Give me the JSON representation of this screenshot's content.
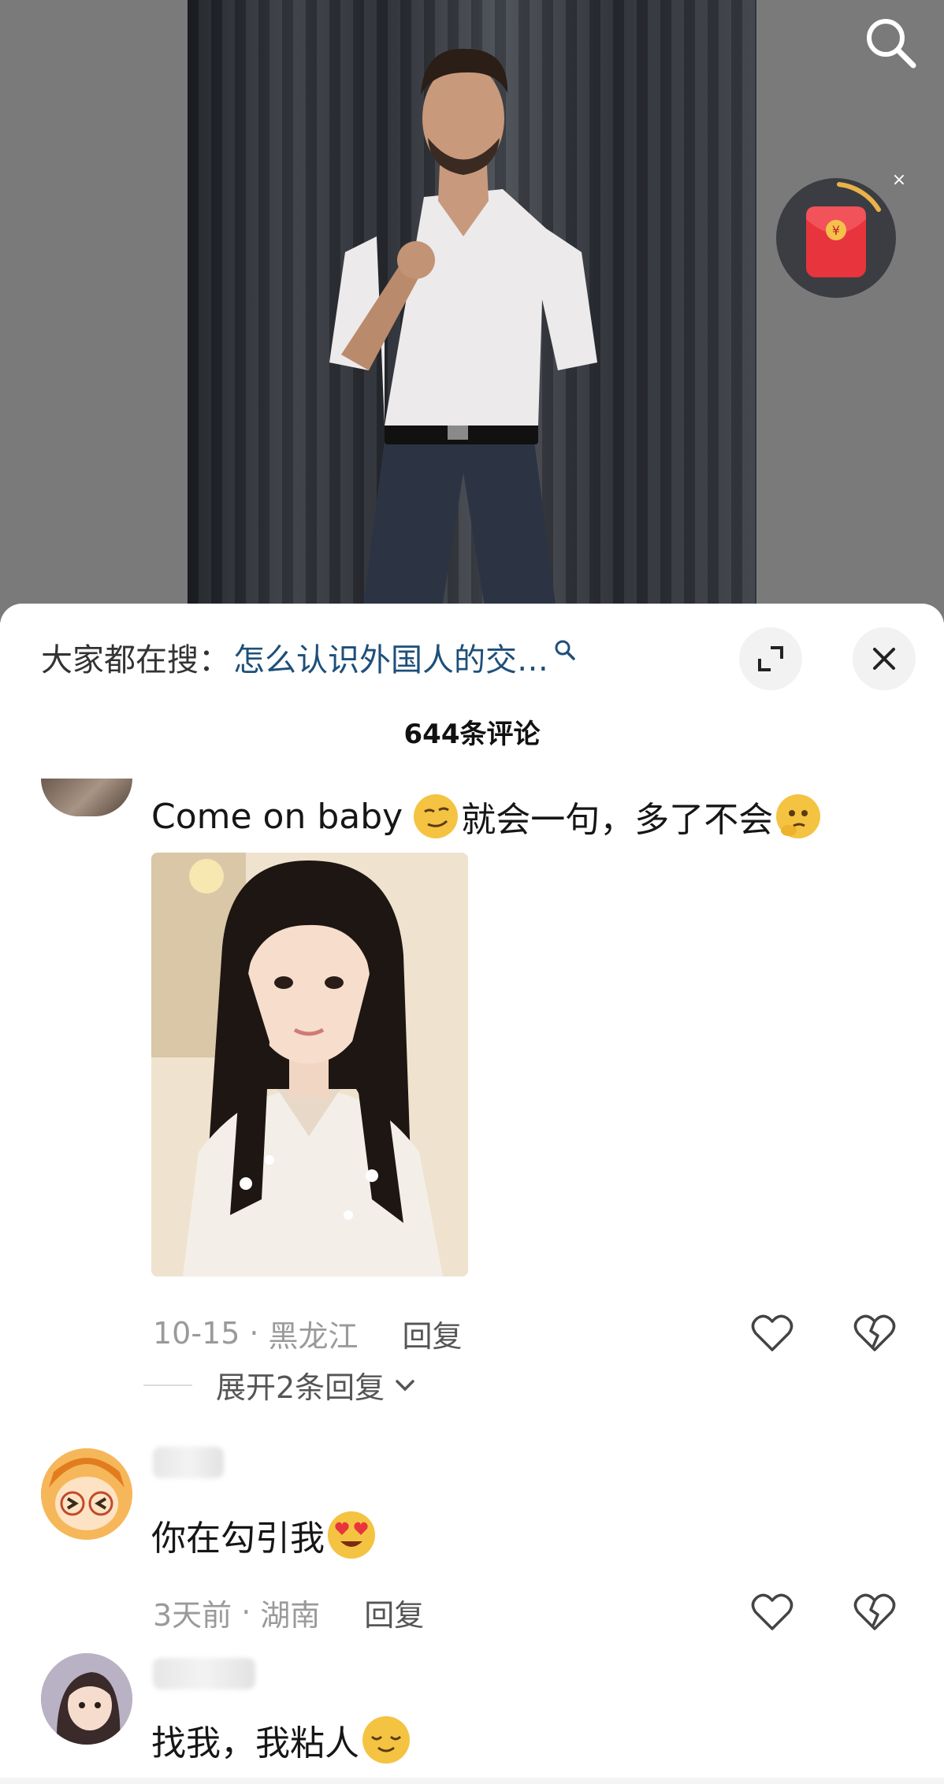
{
  "search_bar": {
    "prefix": "大家都在搜：",
    "query": "怎么认识外国人的交…"
  },
  "comment_count": "644条评论",
  "comments": [
    {
      "text": "Come on baby",
      "text_after_emoji": "就会一句，多了不会",
      "date": "10-15",
      "location": "黑龙江",
      "reply_label": "回复",
      "expand_label": "展开2条回复"
    },
    {
      "text": "你在勾引我",
      "date": "3天前",
      "location": "湖南",
      "reply_label": "回复"
    },
    {
      "text": "找我，我粘人"
    }
  ],
  "colors": {
    "query_link": "#1d4f7a",
    "redpack": "#e8343d",
    "meta_text": "#9a9a9a"
  }
}
